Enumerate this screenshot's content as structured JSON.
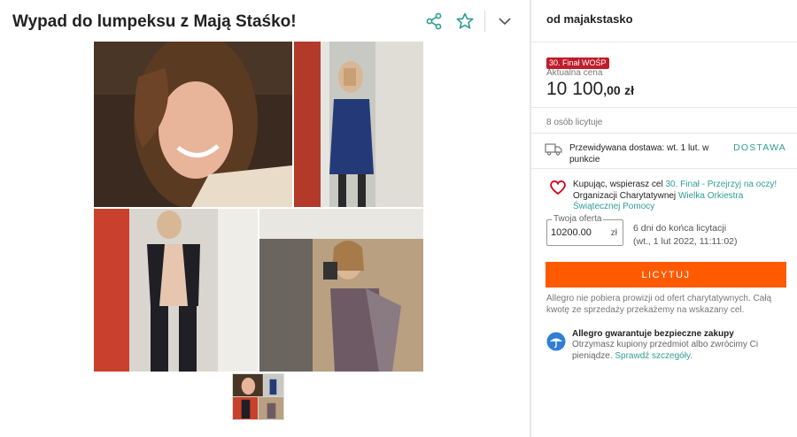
{
  "listing": {
    "title": "Wypad do lumpeksu z Mają Staśko!"
  },
  "actions": {
    "share_icon": "share-icon",
    "star_icon": "star-icon",
    "chevron_icon": "chevron-down-icon"
  },
  "gallery": {
    "photos": [
      "photo-selfie-closeup",
      "photo-blue-dress-mirror",
      "photo-sheer-bodysuit-mirror",
      "photo-sequin-dress-mirror"
    ],
    "thumbnails": [
      "thumbnail-collage"
    ]
  },
  "seller": {
    "label": "od majakstasko"
  },
  "price": {
    "badge": "30. Finał WOŚP",
    "label": "Aktualna cena",
    "main": "10 100",
    "decimals": ",00",
    "currency": "zł"
  },
  "bidders": "8 osób licytuje",
  "delivery": {
    "text": "Przewidywana dostawa: wt. 1 lut. w punkcie",
    "link": "DOSTAWA"
  },
  "charity": {
    "prefix": "Kupując, wspierasz cel",
    "goal_link": "30. Finał - Przejrzyj na oczy!",
    "middle": "Organizacji Charytatywnej",
    "org_link": "Wielka Orkiestra Świątecznej Pomocy"
  },
  "bid": {
    "label": "Twoja oferta",
    "value": "10200.00",
    "currency": "zł",
    "time_left": "6 dni do końca licytacji",
    "end_date": "(wt., 1 lut 2022, 11:11:02)",
    "button": "LICYTUJ"
  },
  "commission": "Allegro nie pobiera prowizji od ofert charytatywnych. Całą kwotę ze sprzedaży przekażemy na wskazany cel.",
  "guarantee": {
    "title": "Allegro gwarantuje bezpieczne zakupy",
    "text": "Otrzymasz kupiony przedmiot albo zwrócimy Ci pieniądze.",
    "link": "Sprawdź szczegóły."
  },
  "colors": {
    "accent_orange": "#ff5a00",
    "link_teal": "#2f9e93",
    "badge_red": "#c01d2a",
    "heart_red": "#d0021b",
    "shield_blue": "#2f7fd6"
  }
}
